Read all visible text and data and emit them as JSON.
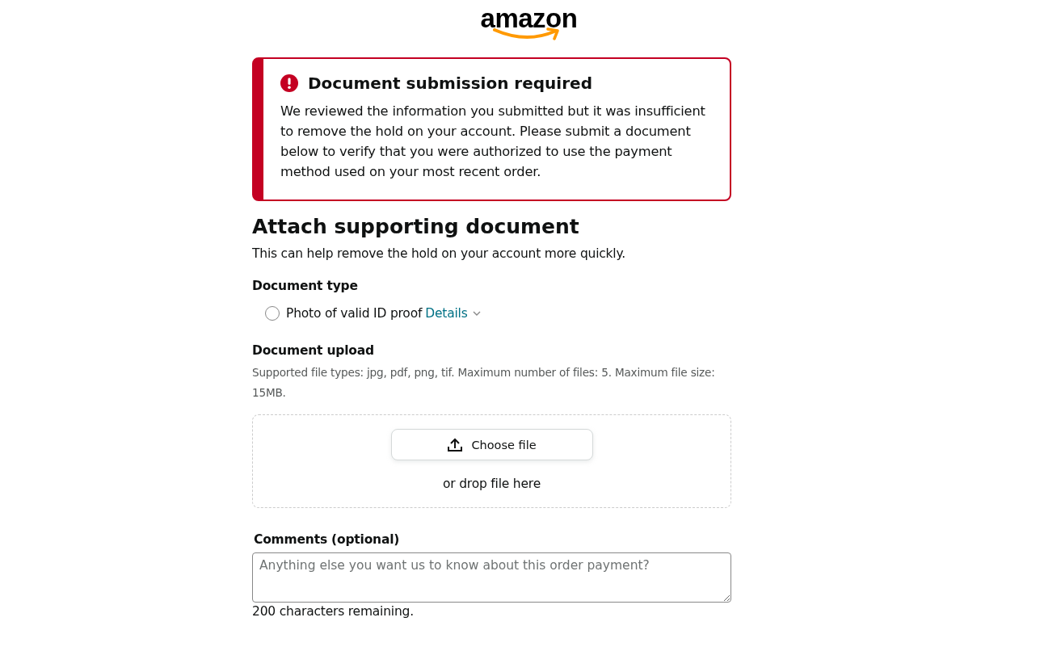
{
  "logo": {
    "text": "amazon"
  },
  "alert": {
    "title": "Document submission required",
    "message": "We reviewed the information you submitted but it was insufficient to remove the hold on your account. Please submit a document below to verify that you were authorized to use the payment method used on your most recent order."
  },
  "heading": "Attach supporting document",
  "subheading": "This can help remove the hold on your account more quickly.",
  "document_type": {
    "label": "Document type",
    "options": [
      {
        "label": "Photo of valid ID proof",
        "link": "Details",
        "selected": false
      }
    ]
  },
  "upload": {
    "label": "Document upload",
    "hint": "Supported file types: jpg, pdf, png, tif. Maximum number of files: 5. Maximum file size: 15MB.",
    "button": "Choose file",
    "drop_text": "or drop file here"
  },
  "comments": {
    "label": "Comments (optional)",
    "placeholder": "Anything else you want us to know about this order payment?",
    "counter": "200 characters remaining."
  }
}
